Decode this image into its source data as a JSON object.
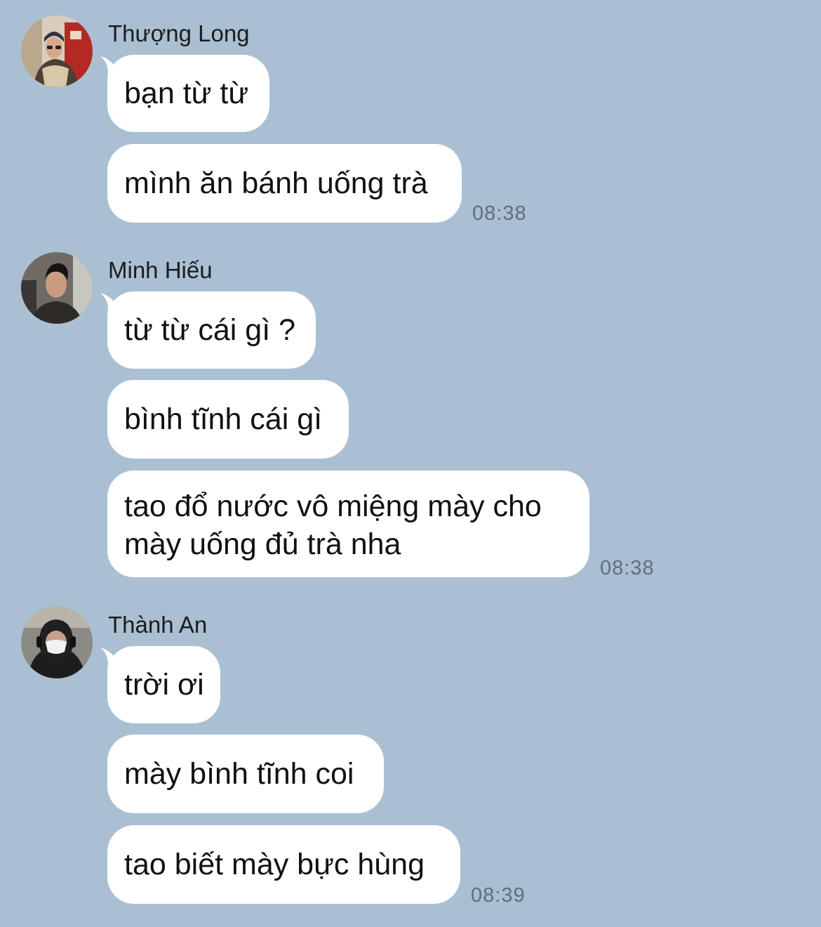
{
  "chat": {
    "groups": [
      {
        "sender": "Thượng Long",
        "avatar_icon": "user-avatar-photo",
        "messages": [
          "bạn từ từ",
          "mình ăn bánh uống trà"
        ],
        "time": "08:38"
      },
      {
        "sender": "Minh Hiếu",
        "avatar_icon": "user-avatar-photo",
        "messages": [
          "từ từ cái gì ?",
          "bình tĩnh cái gì",
          "tao đổ nước vô miệng mày cho\nmày uống đủ trà nha"
        ],
        "time": "08:38"
      },
      {
        "sender": "Thành An",
        "avatar_icon": "user-avatar-photo",
        "messages": [
          "trời ơi",
          "mày bình tĩnh coi",
          "tao biết mày bực hùng"
        ],
        "time": "08:39"
      }
    ]
  },
  "colors": {
    "background": "#aabfd2",
    "bubble": "#ffffff",
    "timestamp": "#5f6e7e"
  }
}
